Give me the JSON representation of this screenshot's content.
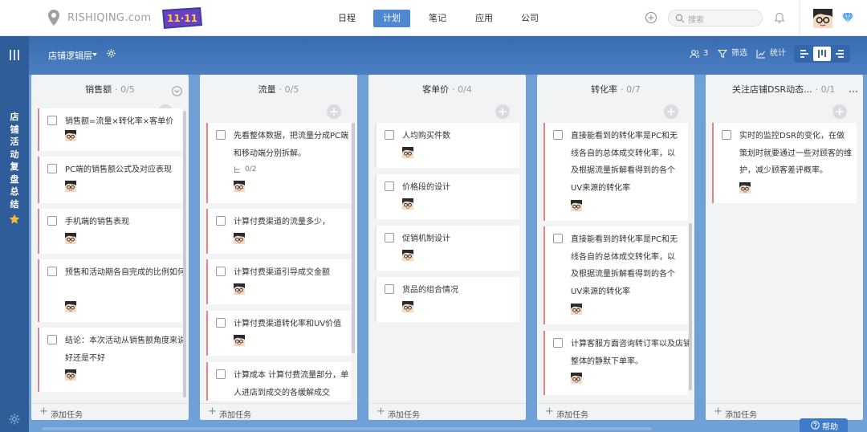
{
  "brand": {
    "name": "RISHIQING.com",
    "promo": "11·11"
  },
  "nav": {
    "items": [
      {
        "label": "日程"
      },
      {
        "label": "计划",
        "active": true
      },
      {
        "label": "笔记"
      },
      {
        "label": "应用"
      },
      {
        "label": "公司"
      }
    ]
  },
  "search": {
    "placeholder": "搜索"
  },
  "sidebar": {
    "project_name": "店铺活动复盘总结"
  },
  "toolbar": {
    "view_name": "店铺逻辑层",
    "members_count": "3",
    "filter_label": "筛选",
    "stats_label": "统计"
  },
  "columns": [
    {
      "title": "销售额",
      "count": "0/5",
      "add_label": "添加任务",
      "cards": [
        {
          "text": "销售额=流量×转化率×客单价"
        },
        {
          "text": "PC端的销售额公式及对应表现"
        },
        {
          "text": "手机端的销售表现"
        },
        {
          "text": "预售和活动期各自完成的比例如何"
        },
        {
          "text": "结论：本次活动从销售额角度来说好还是不好"
        }
      ]
    },
    {
      "title": "流量",
      "count": "0/5",
      "add_label": "添加任务",
      "cards": [
        {
          "text": "先看整体数据，把流量分成PC端和移动端分别拆解。",
          "subtask": "0/2"
        },
        {
          "text": "计算付费渠道的流量多少，"
        },
        {
          "text": "计算付费渠道引导成交金额"
        },
        {
          "text": "计算付费渠道转化率和UV价值"
        },
        {
          "text": "计算成本 计算付费流量部分，单人进店到成交的各缓解成交"
        }
      ]
    },
    {
      "title": "客单价",
      "count": "0/4",
      "add_label": "添加任务",
      "cards": [
        {
          "text": "人均购买件数"
        },
        {
          "text": "价格段的设计"
        },
        {
          "text": "促销机制设计"
        },
        {
          "text": "货品的组合情况"
        }
      ]
    },
    {
      "title": "转化率",
      "count": "0/7",
      "add_label": "添加任务",
      "cards": [
        {
          "text": "直接能看到的转化率是PC和无线各自的总体成交转化率，以及根据流量拆解看得到的各个UV来源的转化率"
        },
        {
          "text": "直接能看到的转化率是PC和无线各自的总体成交转化率，以及根据流量拆解看得到的各个UV来源的转化率"
        },
        {
          "text": "计算客服方面咨询转订率以及店铺整体的静默下单率。"
        }
      ]
    },
    {
      "title": "关注店铺DSR动态...",
      "count": "0/1",
      "add_label": "添加任务",
      "cards": [
        {
          "text": "实时的监控DSR的变化，在做策划时就要通过一些对顾客的维护，减少顾客差评概率。"
        }
      ]
    }
  ],
  "help": {
    "label": "帮助"
  },
  "colors": {
    "accent": "#4f87d0",
    "sidebar": "#2f5d9a",
    "card_marker": "#e38484"
  },
  "icons": [
    "logo-icon",
    "menu-icon",
    "star-icon",
    "gear-icon",
    "members-icon",
    "filter-icon",
    "stats-icon",
    "add-circle-icon",
    "bell-icon",
    "search-icon",
    "diamond-icon",
    "help-icon",
    "subtask-icon"
  ]
}
